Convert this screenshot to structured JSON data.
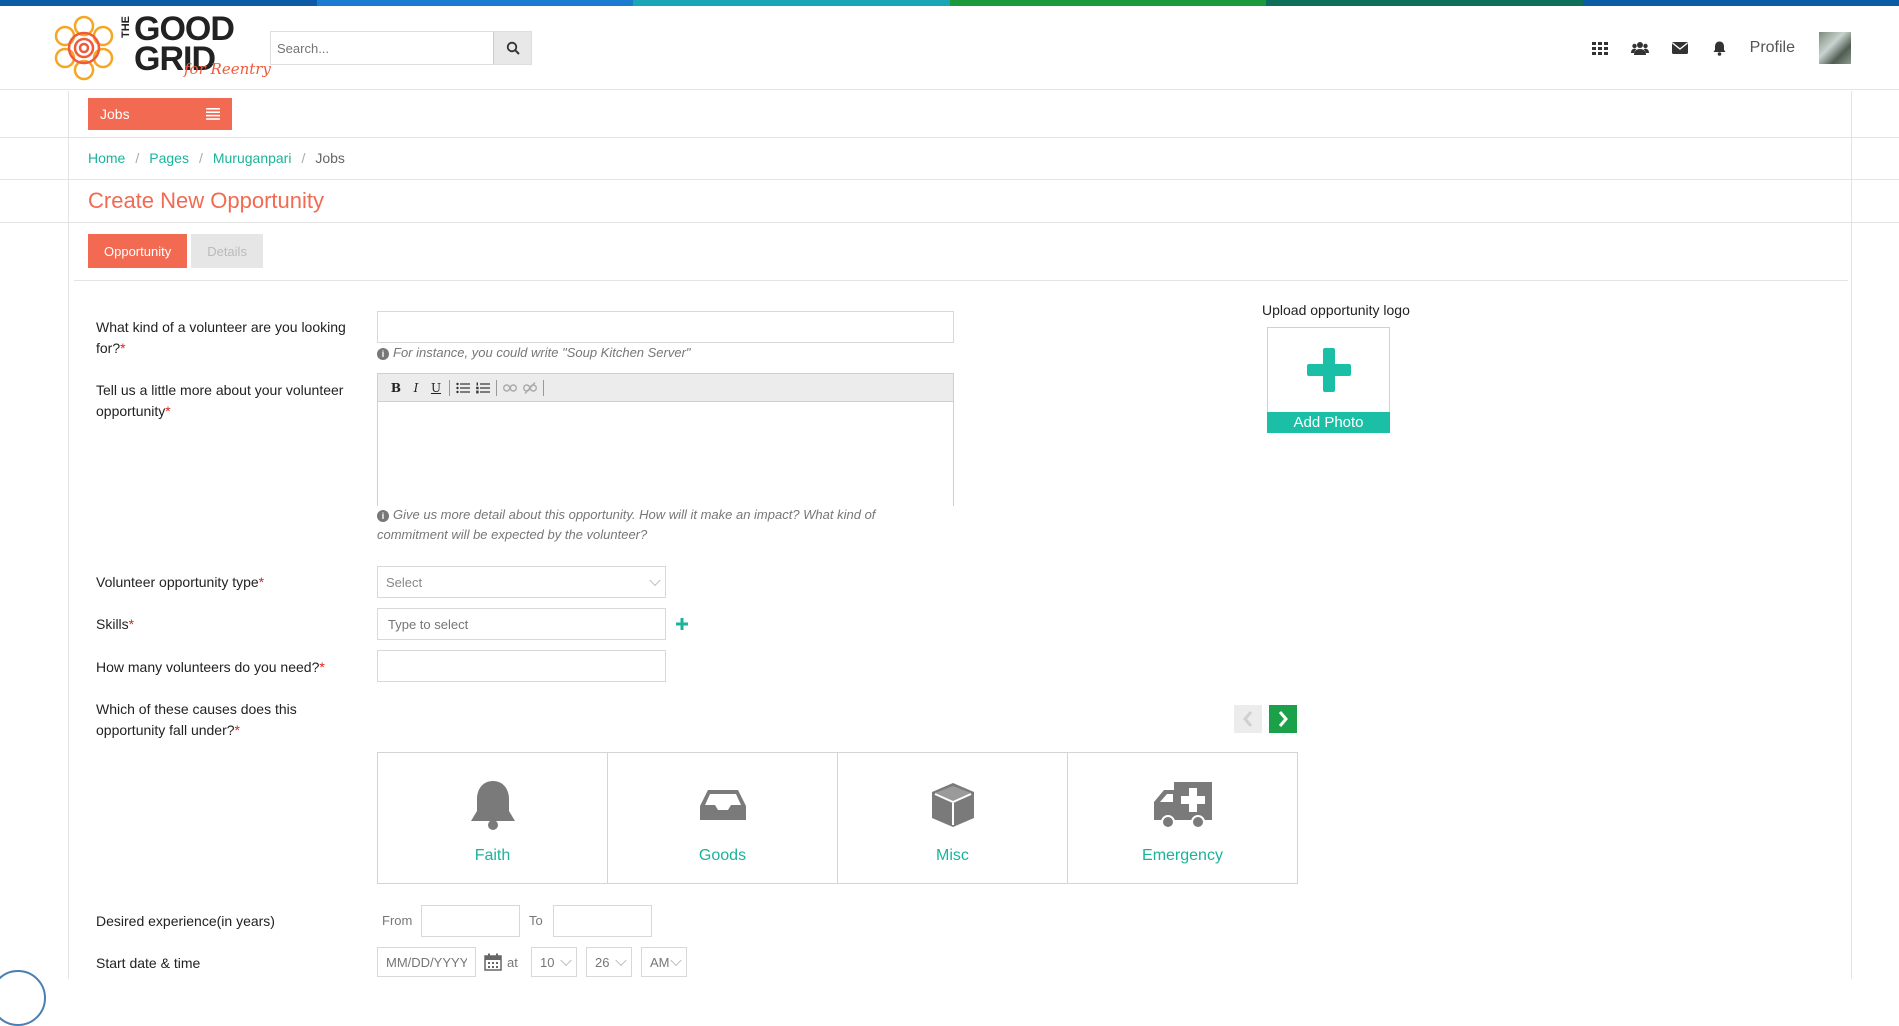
{
  "header": {
    "logo_line1": "GOOD",
    "logo_line2": "GRID",
    "logo_the": "THE",
    "logo_sub": "for Reentry",
    "search_placeholder": "Search...",
    "profile_label": "Profile"
  },
  "stripe_colors": [
    "#0d5aa7",
    "#1a7bd0",
    "#1aa6b7",
    "#1a9a3a",
    "#0f6e5a",
    "#0d5aa7"
  ],
  "menu": {
    "jobs_label": "Jobs"
  },
  "breadcrumb": {
    "home": "Home",
    "pages": "Pages",
    "user": "Muruganpari",
    "current": "Jobs",
    "sep": "/"
  },
  "page_title": "Create New Opportunity",
  "tabs": {
    "opportunity": "Opportunity",
    "details": "Details"
  },
  "form": {
    "q_kind_line1": "What kind of a volunteer are you looking",
    "q_kind_line2": "for?",
    "q_kind_hint": "For instance, you could write \"Soup Kitchen Server\"",
    "q_more_line1": "Tell us a little more about your volunteer",
    "q_more_line2": "opportunity",
    "q_more_hint_line1": "Give us more detail about this opportunity. How will it make an impact? What kind of",
    "q_more_hint_line2": "commitment will be expected by the volunteer?",
    "q_type": "Volunteer opportunity type",
    "q_type_value": "Select",
    "q_skills": "Skills",
    "q_skills_placeholder": "Type to select",
    "q_count": "How many volunteers do you need?",
    "q_causes_line1": "Which of these causes does this",
    "q_causes_line2": "opportunity fall under?",
    "q_experience": "Desired experience(in years)",
    "exp_from": "From",
    "exp_to": "To",
    "q_start": "Start date & time",
    "date_placeholder": "MM/DD/YYYY",
    "at": "at",
    "hour": "10",
    "minute": "26",
    "ampm": "AM",
    "required_mark": "*"
  },
  "editor": {
    "bold": "B",
    "italic": "I",
    "underline": "U"
  },
  "upload": {
    "title": "Upload opportunity logo",
    "button": "Add Photo"
  },
  "causes": [
    {
      "name": "Faith",
      "icon": "bell-icon"
    },
    {
      "name": "Goods",
      "icon": "inbox-icon"
    },
    {
      "name": "Misc",
      "icon": "cube-icon"
    },
    {
      "name": "Emergency",
      "icon": "ambulance-icon"
    }
  ],
  "colors": {
    "accent": "#f26a52",
    "teal": "#1bb39a",
    "add_photo": "#1bbfa6",
    "carousel_next": "#1aa14a"
  }
}
